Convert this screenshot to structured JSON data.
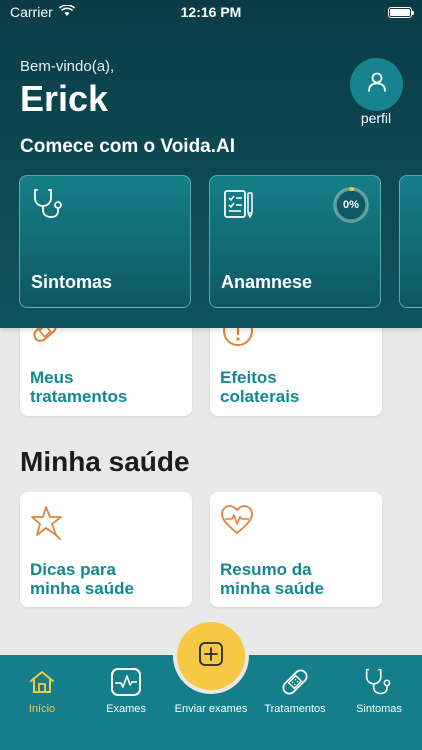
{
  "status_bar": {
    "carrier": "Carrier",
    "time": "12:16 PM"
  },
  "header": {
    "welcome": "Bem-vindo(a),",
    "user_name": "Erick",
    "profile_label": "perfil",
    "section_title": "Comece com o Voida.AI",
    "cards": [
      {
        "label": "Sintomas",
        "icon": "stethoscope-icon"
      },
      {
        "label": "Anamnese",
        "icon": "clipboard-pen-icon",
        "progress_text": "0%",
        "progress_value": 0
      }
    ]
  },
  "treatments": [
    {
      "line1": "Meus",
      "line2": "tratamentos",
      "icon": "bandage-icon"
    },
    {
      "line1": "Efeitos",
      "line2": "colaterais",
      "icon": "alert-icon"
    }
  ],
  "health": {
    "title": "Minha saúde",
    "cards": [
      {
        "line1": "Dicas para",
        "line2": "minha saúde",
        "icon": "star-icon"
      },
      {
        "line1": "Resumo da",
        "line2": "minha saúde",
        "icon": "heart-pulse-icon"
      }
    ]
  },
  "nav": {
    "items": [
      {
        "label": "Início",
        "icon": "home-icon",
        "active": true
      },
      {
        "label": "Exames",
        "icon": "exam-icon"
      },
      {
        "label": "Enviar exames",
        "icon": "plus-icon"
      },
      {
        "label": "Tratamentos",
        "icon": "bandage-icon"
      },
      {
        "label": "Sintomas",
        "icon": "stethoscope-icon"
      }
    ]
  },
  "colors": {
    "header": "#0d4a55",
    "accent": "#147f8a",
    "teal_text": "#138892",
    "orange": "#e1803a",
    "yellow": "#f6c844"
  }
}
